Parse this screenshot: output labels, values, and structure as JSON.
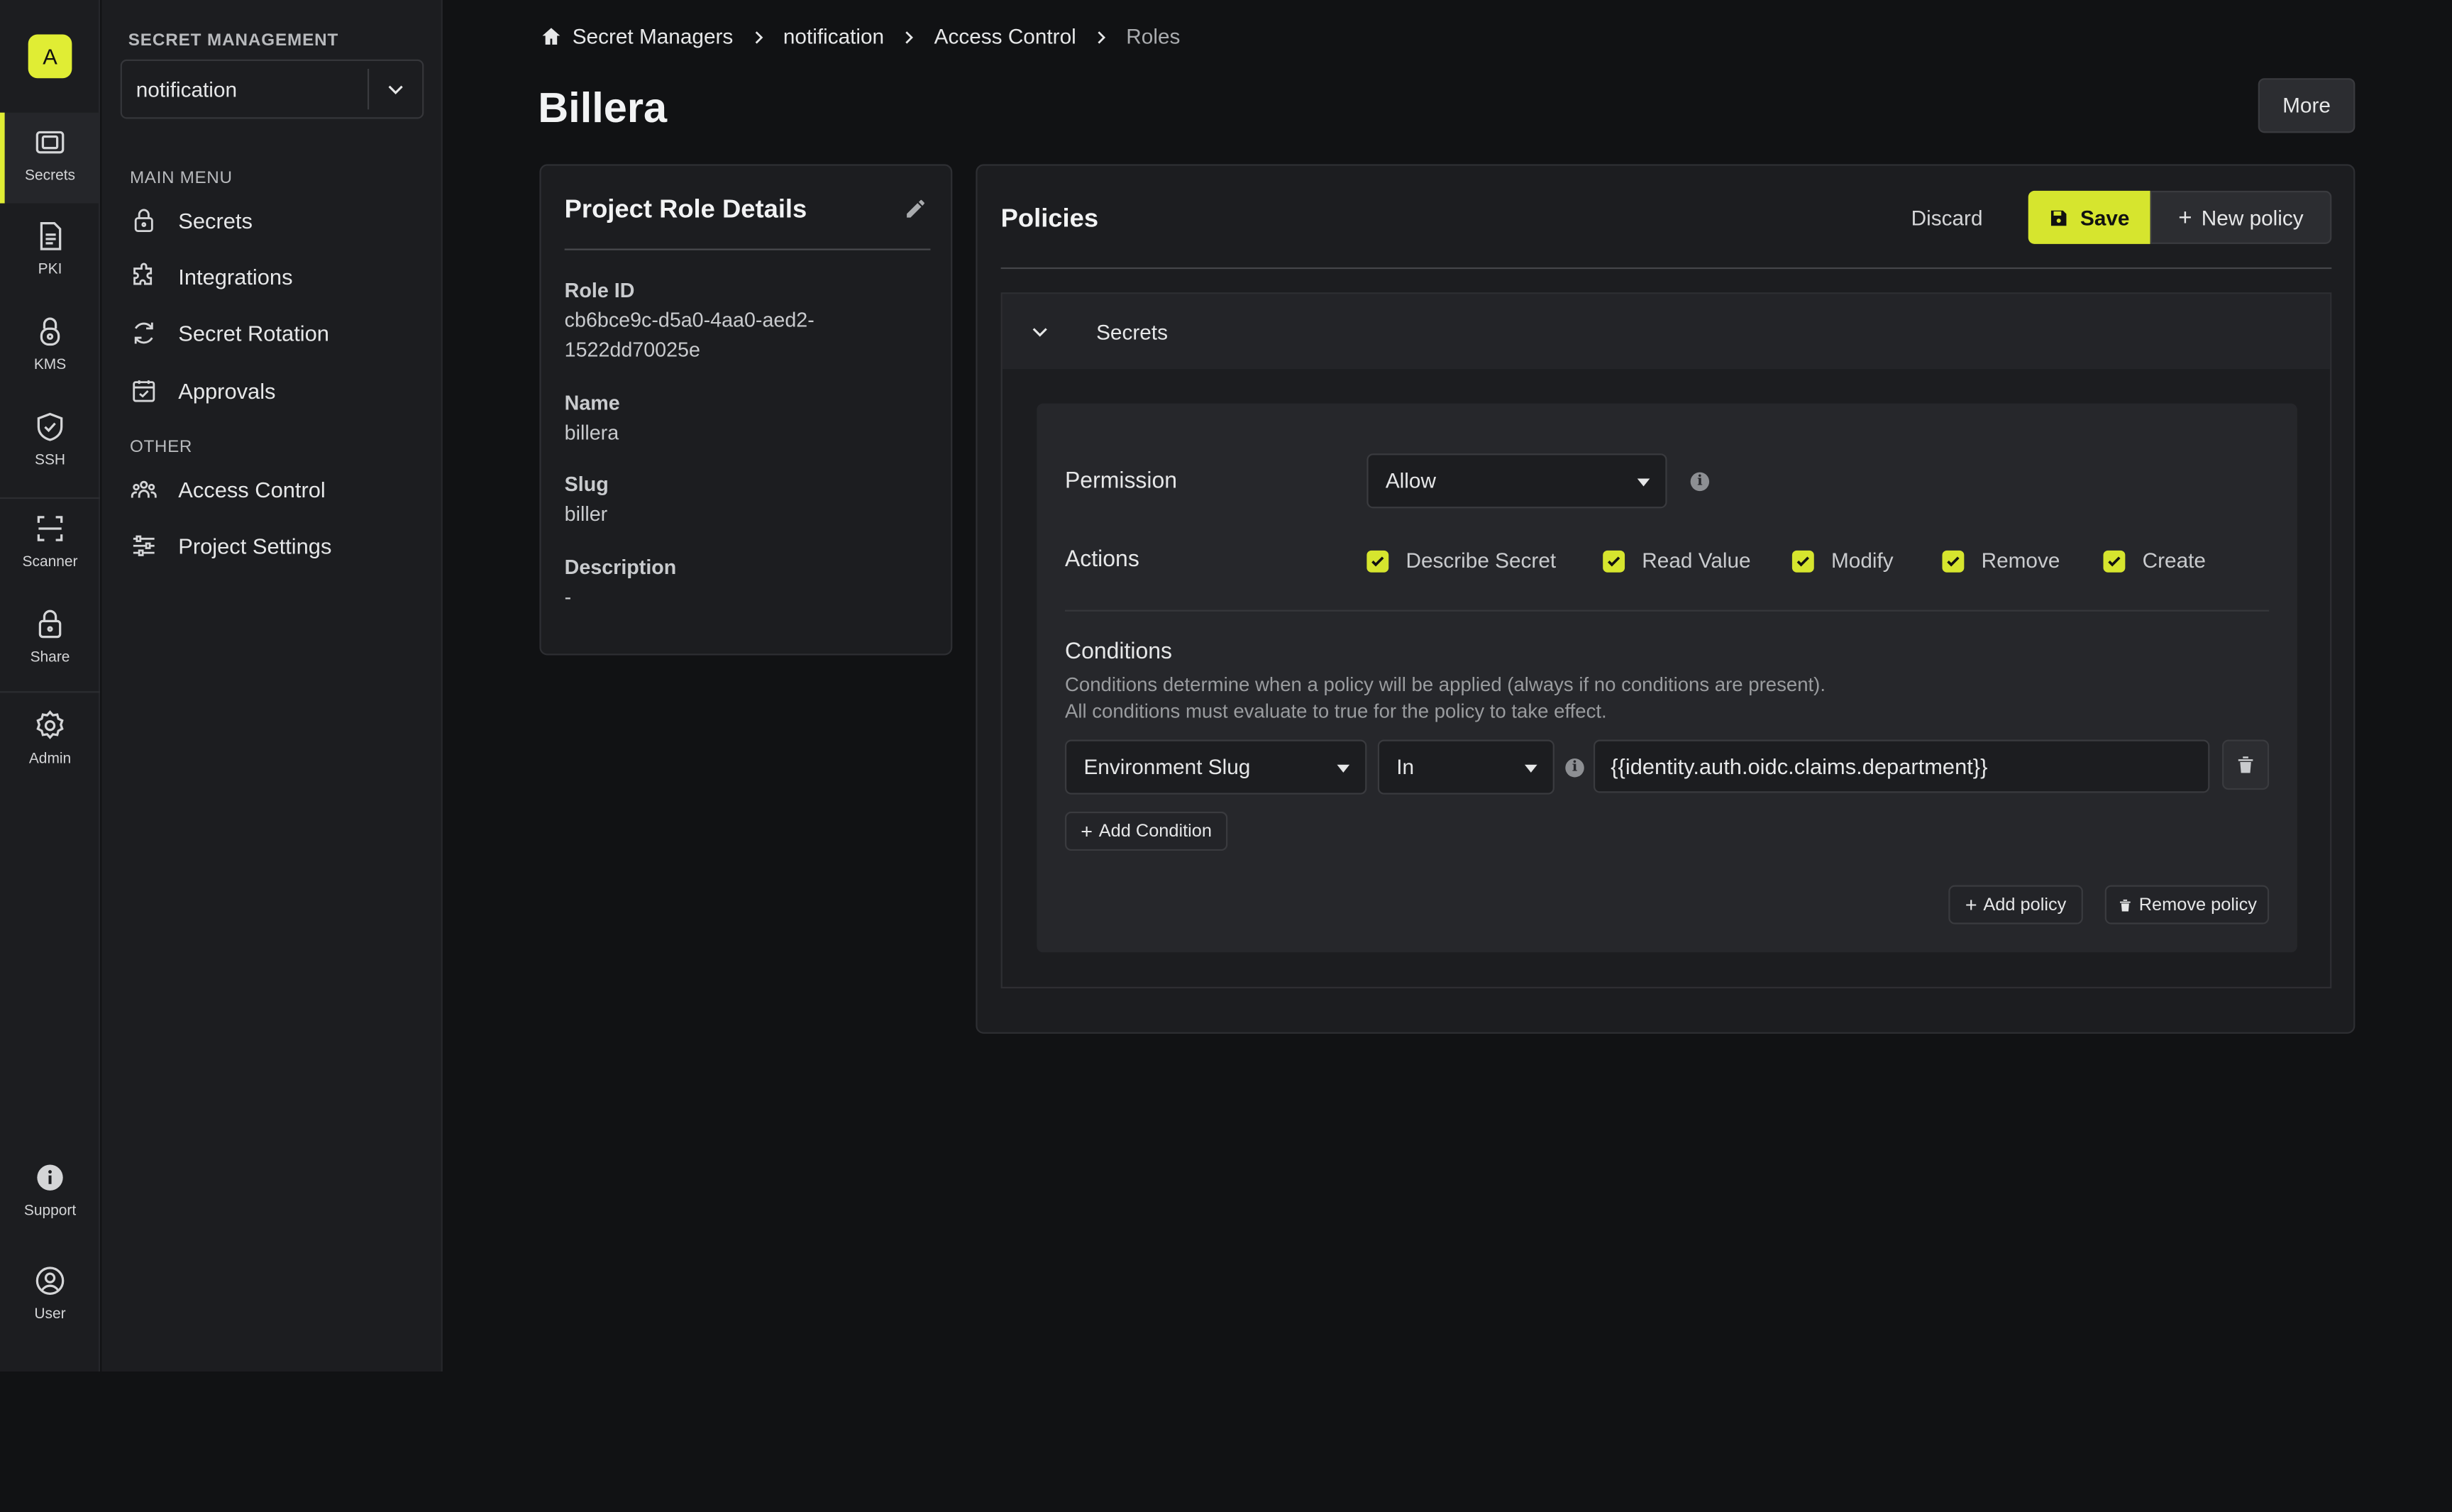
{
  "rail": {
    "org_initial": "A",
    "items": [
      {
        "label": "Secrets",
        "icon": "vault-icon"
      },
      {
        "label": "PKI",
        "icon": "certificate-icon"
      },
      {
        "label": "KMS",
        "icon": "kms-lock-icon"
      },
      {
        "label": "SSH",
        "icon": "shield-check-icon"
      },
      {
        "label": "Scanner",
        "icon": "scan-icon"
      },
      {
        "label": "Share",
        "icon": "lock-icon"
      },
      {
        "label": "Admin",
        "icon": "gear-icon"
      },
      {
        "label": "Support",
        "icon": "info-icon"
      },
      {
        "label": "User",
        "icon": "user-icon"
      }
    ]
  },
  "sidebar": {
    "heading": "SECRET MANAGEMENT",
    "project": "notification",
    "main_menu_label": "MAIN MENU",
    "main_items": [
      {
        "label": "Secrets",
        "icon": "lock-icon"
      },
      {
        "label": "Integrations",
        "icon": "puzzle-icon"
      },
      {
        "label": "Secret Rotation",
        "icon": "rotate-icon"
      },
      {
        "label": "Approvals",
        "icon": "calendar-check-icon"
      }
    ],
    "other_label": "OTHER",
    "other_items": [
      {
        "label": "Access Control",
        "icon": "users-icon"
      },
      {
        "label": "Project Settings",
        "icon": "sliders-icon"
      }
    ]
  },
  "breadcrumb": [
    "Secret Managers",
    "notification",
    "Access Control",
    "Roles"
  ],
  "page_title": "Billera",
  "more_label": "More",
  "details": {
    "title": "Project Role Details",
    "role_id_label": "Role ID",
    "role_id": "cb6bce9c-d5a0-4aa0-aed2-1522dd70025e",
    "name_label": "Name",
    "name": "billera",
    "slug_label": "Slug",
    "slug": "biller",
    "description_label": "Description",
    "description": "-"
  },
  "policies": {
    "title": "Policies",
    "discard_label": "Discard",
    "save_label": "Save",
    "new_policy_label": "New policy",
    "section_title": "Secrets",
    "permission_label": "Permission",
    "permission_value": "Allow",
    "actions_label": "Actions",
    "actions": [
      {
        "label": "Describe Secret",
        "checked": true
      },
      {
        "label": "Read Value",
        "checked": true
      },
      {
        "label": "Modify",
        "checked": true
      },
      {
        "label": "Remove",
        "checked": true
      },
      {
        "label": "Create",
        "checked": true
      }
    ],
    "conditions_label": "Conditions",
    "conditions_desc_1": "Conditions determine when a policy will be applied (always if no conditions are present).",
    "conditions_desc_2": "All conditions must evaluate to true for the policy to take effect.",
    "condition": {
      "field": "Environment Slug",
      "operator": "In",
      "value": "{{identity.auth.oidc.claims.department}}"
    },
    "add_condition_label": "Add Condition",
    "add_policy_label": "Add policy",
    "remove_policy_label": "Remove policy"
  },
  "colors": {
    "accent": "#d6e52e",
    "background": "#111214",
    "panel": "#1c1d20"
  }
}
